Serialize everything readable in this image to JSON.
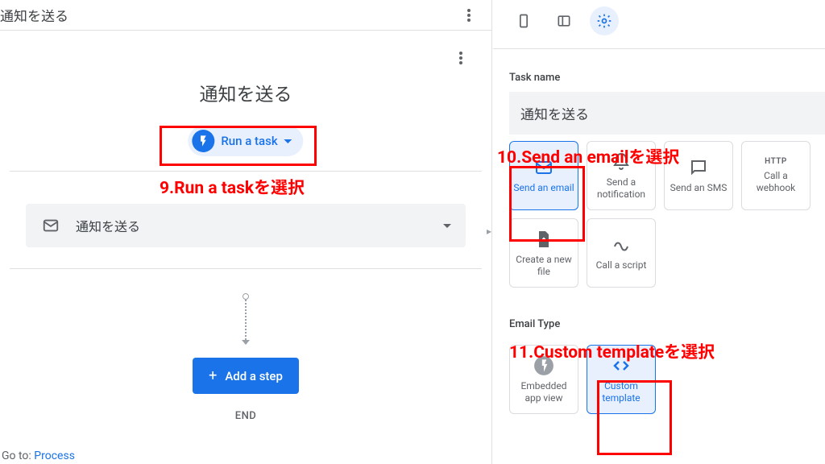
{
  "header": {
    "title": "通知を送る"
  },
  "process": {
    "title": "通知を送る",
    "run_task_label": "Run a task",
    "dropdown_value": "通知を送る",
    "add_step_label": "Add a step",
    "end_label": "END"
  },
  "goto": {
    "prefix": "Go to: ",
    "link": "Process"
  },
  "annotations": {
    "a9": "9.Run a taskを選択",
    "a10": "10.Send an emailを選択",
    "a11": "11.Custom templateを選択"
  },
  "right": {
    "task_name_label": "Task name",
    "task_name_value": "通知を送る",
    "tiles": [
      {
        "label": "Send an email"
      },
      {
        "label": "Send a notification"
      },
      {
        "label": "Send an SMS"
      },
      {
        "label": "Call a webhook",
        "badge": "HTTP"
      },
      {
        "label": "Create a new file"
      },
      {
        "label": "Call a script"
      }
    ],
    "email_type_label": "Email Type",
    "email_tiles": [
      {
        "label": "Embedded app view"
      },
      {
        "label": "Custom template"
      }
    ]
  }
}
